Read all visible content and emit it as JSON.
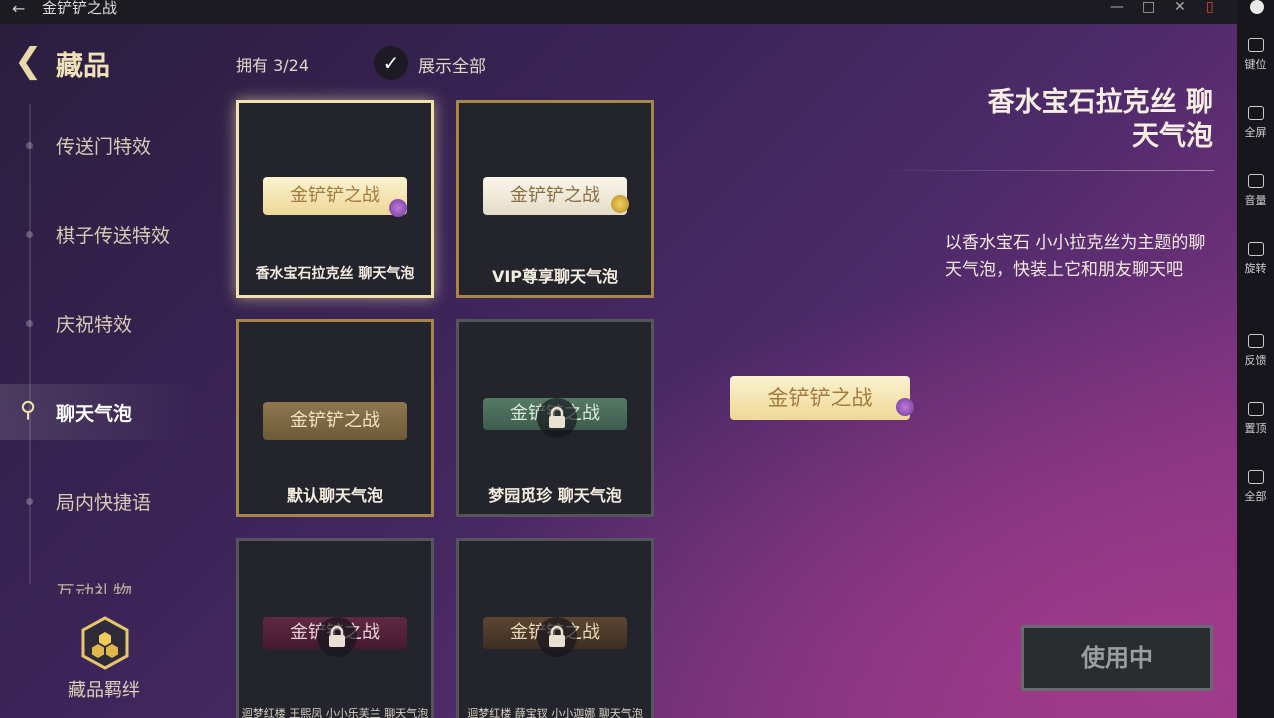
{
  "window": {
    "title": "金铲铲之战",
    "back_icon": "arrow-left-icon",
    "controls": [
      "minimize-icon",
      "maximize-icon",
      "close-icon",
      "phone-icon"
    ]
  },
  "emulator_sidebar": {
    "items": [
      {
        "label": "键位",
        "icon": "keyboard-icon"
      },
      {
        "label": "全屏",
        "icon": "fullscreen-icon"
      },
      {
        "label": "音量",
        "icon": "volume-icon"
      },
      {
        "label": "旋转",
        "icon": "rotate-icon"
      },
      {
        "label": "反馈",
        "icon": "feedback-icon"
      },
      {
        "label": "置顶",
        "icon": "pin-icon"
      },
      {
        "label": "全部",
        "icon": "grid-icon"
      }
    ]
  },
  "page": {
    "title": "藏品",
    "owned": "拥有 3/24",
    "show_all": "展示全部",
    "show_all_checked": true
  },
  "nav": {
    "items": [
      {
        "label": "传送门特效",
        "active": false
      },
      {
        "label": "棋子传送特效",
        "active": false
      },
      {
        "label": "庆祝特效",
        "active": false
      },
      {
        "label": "聊天气泡",
        "active": true
      },
      {
        "label": "局内快捷语",
        "active": false
      },
      {
        "label": "互动礼物",
        "active": false
      }
    ],
    "bond_label": "藏品羁绊"
  },
  "cards": [
    {
      "banner": "金铲铲之战",
      "name": "香水宝石拉克丝  聊天气泡",
      "state": "selected",
      "locked": false
    },
    {
      "banner": "金铲铲之战",
      "name": "VIP尊享聊天气泡",
      "state": "owned",
      "locked": false
    },
    {
      "banner": "金铲铲之战",
      "name": "默认聊天气泡",
      "state": "owned",
      "locked": false
    },
    {
      "banner": "金铲铲之战",
      "name": "梦园觅珍  聊天气泡",
      "state": "locked",
      "locked": true
    },
    {
      "banner": "金铲铲之战",
      "name": "迴梦红楼  王熙凤  小小乐芙兰  聊天气泡",
      "state": "locked",
      "locked": true
    },
    {
      "banner": "金铲铲之战",
      "name": "迴梦红楼  薛宝钗  小小迦娜  聊天气泡",
      "state": "locked",
      "locked": true
    }
  ],
  "detail": {
    "title_line1": "香水宝石拉克丝  聊",
    "title_line2": "天气泡",
    "description": "以香水宝石  小小拉克丝为主题的聊天气泡，快装上它和朋友聊天吧",
    "preview_text": "金铲铲之战",
    "use_button": "使用中"
  }
}
